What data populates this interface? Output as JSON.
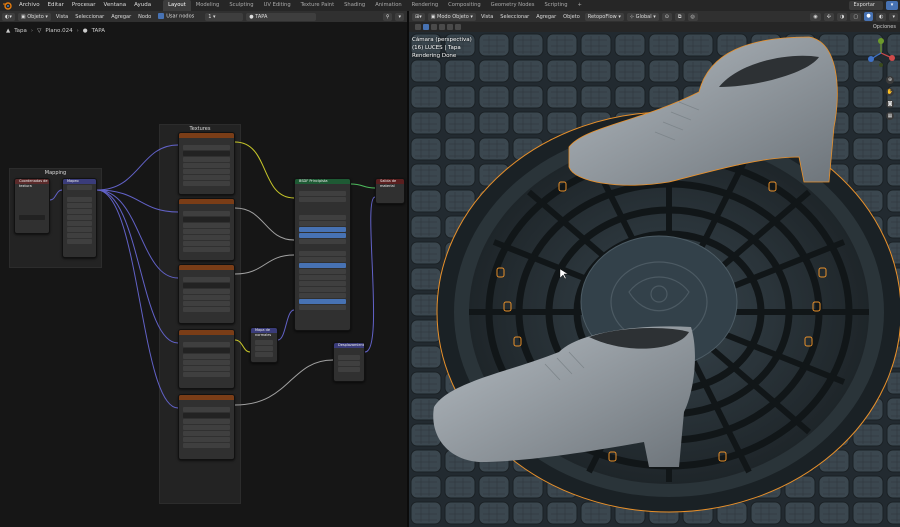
{
  "topbar": {
    "menus": [
      "Archivo",
      "Editar",
      "Procesar",
      "Ventana",
      "Ayuda"
    ],
    "workspaces": [
      "Layout",
      "Modeling",
      "Sculpting",
      "UV Editing",
      "Texture Paint",
      "Shading",
      "Animation",
      "Rendering",
      "Compositing",
      "Geometry Nodes",
      "Scripting",
      "+"
    ],
    "active_workspace": "Layout",
    "export_label": "Exportar"
  },
  "node_editor": {
    "object_mode": "Objeto",
    "menus": [
      "Vista",
      "Seleccionar",
      "Agregar",
      "Nodo"
    ],
    "use_nodes_label": "Usar nodos",
    "slot": "1",
    "material": "TAPA",
    "breadcrumb": [
      "Tapa",
      "Plano.024",
      "TAPA"
    ],
    "frames": [
      {
        "label": "Mapping"
      },
      {
        "label": "Textures"
      }
    ],
    "nodes": {
      "texcoord": "Coordenadas de textura",
      "mapping": "Mapeo",
      "bsdf": "BSDF Principista",
      "output": "Salida de material",
      "normal_map": "Mapa de normales",
      "displacement": "Desplazamiento"
    }
  },
  "viewport": {
    "mode": "Modo Objeto",
    "menus": [
      "Vista",
      "Seleccionar",
      "Agregar",
      "Objeto"
    ],
    "retopo": "RetopoFlow",
    "transform": "Global",
    "options": "Opciones",
    "info_line1": "Cámara (perspectiva)",
    "info_line2": "(16) LUCES | Tapa",
    "info_line3": "Rendering Done"
  },
  "colors": {
    "accent": "#4772b3",
    "texture_header": "#7a3d17",
    "shader_header": "#1e5a34",
    "selection_orange": "#e8902a"
  }
}
